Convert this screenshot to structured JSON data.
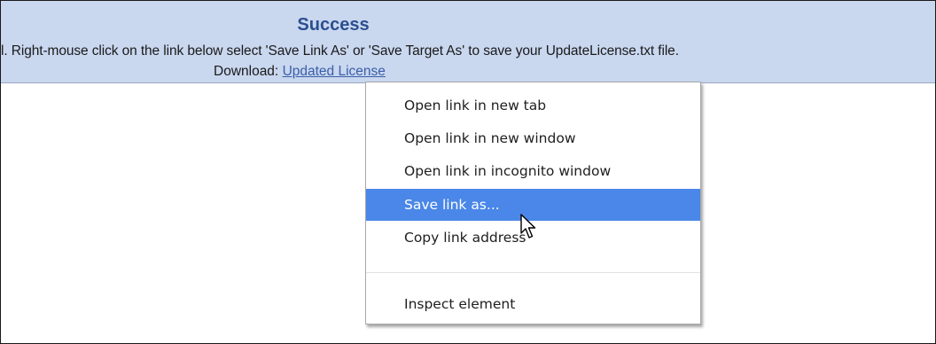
{
  "banner": {
    "title": "Success",
    "instructions": "l. Right-mouse click on the link below select 'Save Link As' or 'Save Target As' to save your UpdateLicense.txt file.",
    "download_label": "Download:",
    "download_link_text": "Updated License"
  },
  "context_menu": {
    "items": [
      {
        "label": "Open link in new tab"
      },
      {
        "label": "Open link in new window"
      },
      {
        "label": "Open link in incognito window"
      },
      {
        "label": "Save link as...",
        "highlighted": true
      },
      {
        "label": "Copy link address"
      },
      {
        "label": "Inspect element"
      }
    ]
  },
  "colors": {
    "banner_bg": "#c9d7ef",
    "title": "#2b4f8f",
    "link": "#3a5fa8",
    "menu_highlight": "#4a87e8"
  },
  "icons": {
    "cursor": "mouse-pointer-icon"
  }
}
